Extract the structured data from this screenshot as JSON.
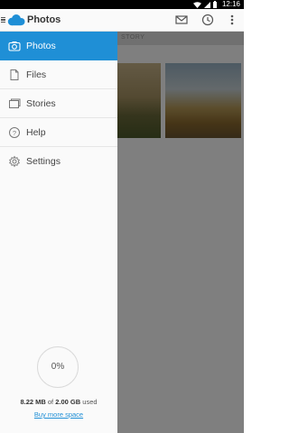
{
  "status_bar": {
    "time": "12:16"
  },
  "app_bar": {
    "title": "Photos"
  },
  "banner": {
    "text": "STORY"
  },
  "drawer": {
    "items": [
      {
        "label": "Photos",
        "icon": "camera-icon",
        "active": true
      },
      {
        "label": "Files",
        "icon": "file-icon",
        "active": false
      },
      {
        "label": "Stories",
        "icon": "stories-icon",
        "active": false
      },
      {
        "label": "Help",
        "icon": "help-icon",
        "active": false
      },
      {
        "label": "Settings",
        "icon": "gear-icon",
        "active": false
      }
    ]
  },
  "storage": {
    "percent_label": "0%",
    "used": "8.22 MB",
    "of_text": "of",
    "total": "2.00 GB",
    "suffix": "used",
    "buy_label": "Buy more space"
  },
  "colors": {
    "accent": "#1f8fd6"
  }
}
